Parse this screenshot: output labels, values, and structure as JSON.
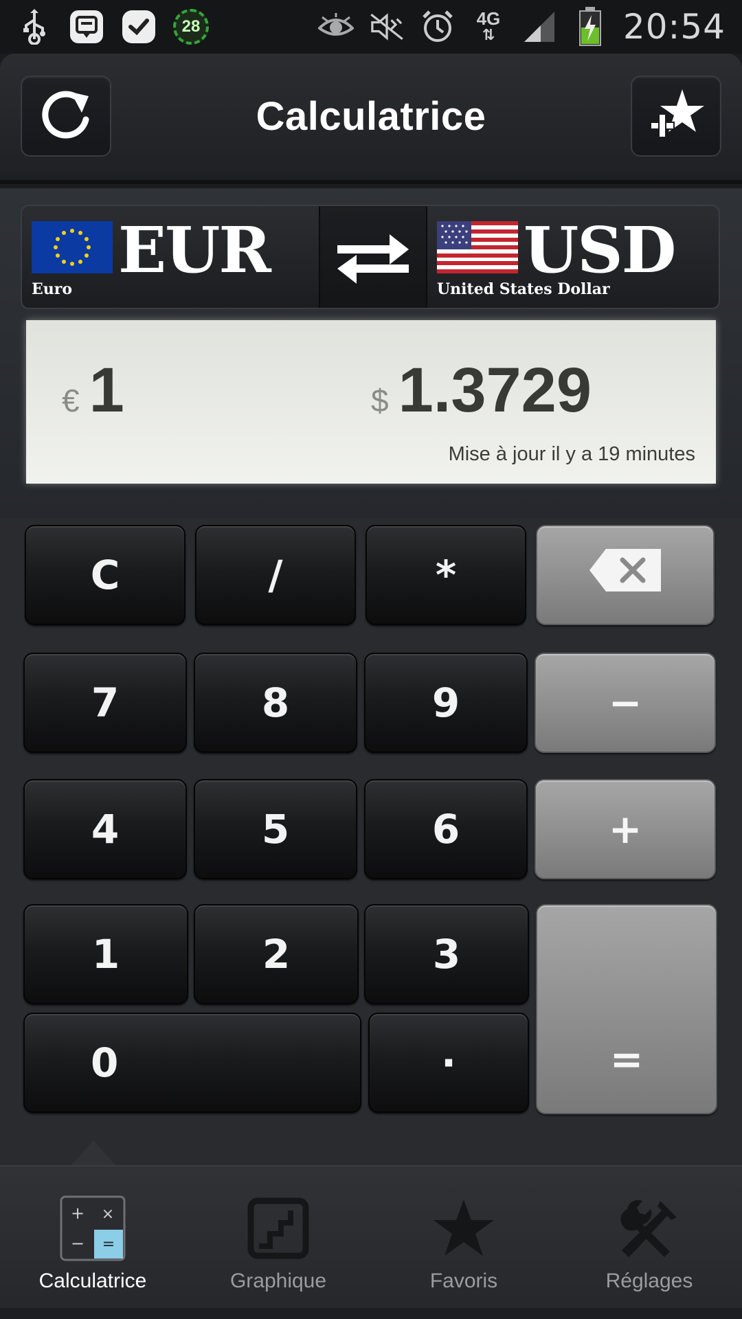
{
  "status_bar": {
    "time": "20:54",
    "network": "4G",
    "badge": "28",
    "icons": [
      "usb-icon",
      "message-icon",
      "check-chat-icon",
      "badge-28-icon",
      "eye-icon",
      "mute-icon",
      "alarm-icon",
      "network-4g-icon",
      "signal-icon",
      "battery-charging-icon"
    ]
  },
  "header": {
    "title": "Calculatrice",
    "left_icon": "refresh-icon",
    "right_icon": "add-favorite-icon"
  },
  "currency": {
    "from": {
      "code": "EUR",
      "name": "Euro",
      "symbol": "€",
      "amount": "1",
      "flag": "eu-flag-icon"
    },
    "to": {
      "code": "USD",
      "name": "United States Dollar",
      "symbol": "$",
      "amount": "1.3729",
      "flag": "us-flag-icon"
    },
    "swap_icon": "swap-arrows-icon",
    "update_text": "Mise à jour il y a 19 minutes"
  },
  "keypad": {
    "clear": "C",
    "divide": "/",
    "multiply": "*",
    "backspace_icon": "backspace-icon",
    "k7": "7",
    "k8": "8",
    "k9": "9",
    "minus": "−",
    "k4": "4",
    "k5": "5",
    "k6": "6",
    "plus": "+",
    "k1": "1",
    "k2": "2",
    "k3": "3",
    "k0": "0",
    "dot": "·",
    "equals": "="
  },
  "nav": {
    "items": [
      {
        "label": "Calculatrice",
        "icon": "calculator-icon",
        "active": true
      },
      {
        "label": "Graphique",
        "icon": "chart-icon",
        "active": false
      },
      {
        "label": "Favoris",
        "icon": "star-icon",
        "active": false
      },
      {
        "label": "Réglages",
        "icon": "settings-tools-icon",
        "active": false
      }
    ]
  },
  "colors": {
    "result_panel": "#eceee9",
    "key_dark": "#1a1b1d",
    "key_light": "#8e8e8e",
    "calc_icon_accent": "#8ccde8",
    "nav_active": "#ffffff",
    "nav_inactive": "#9a9c9f"
  }
}
